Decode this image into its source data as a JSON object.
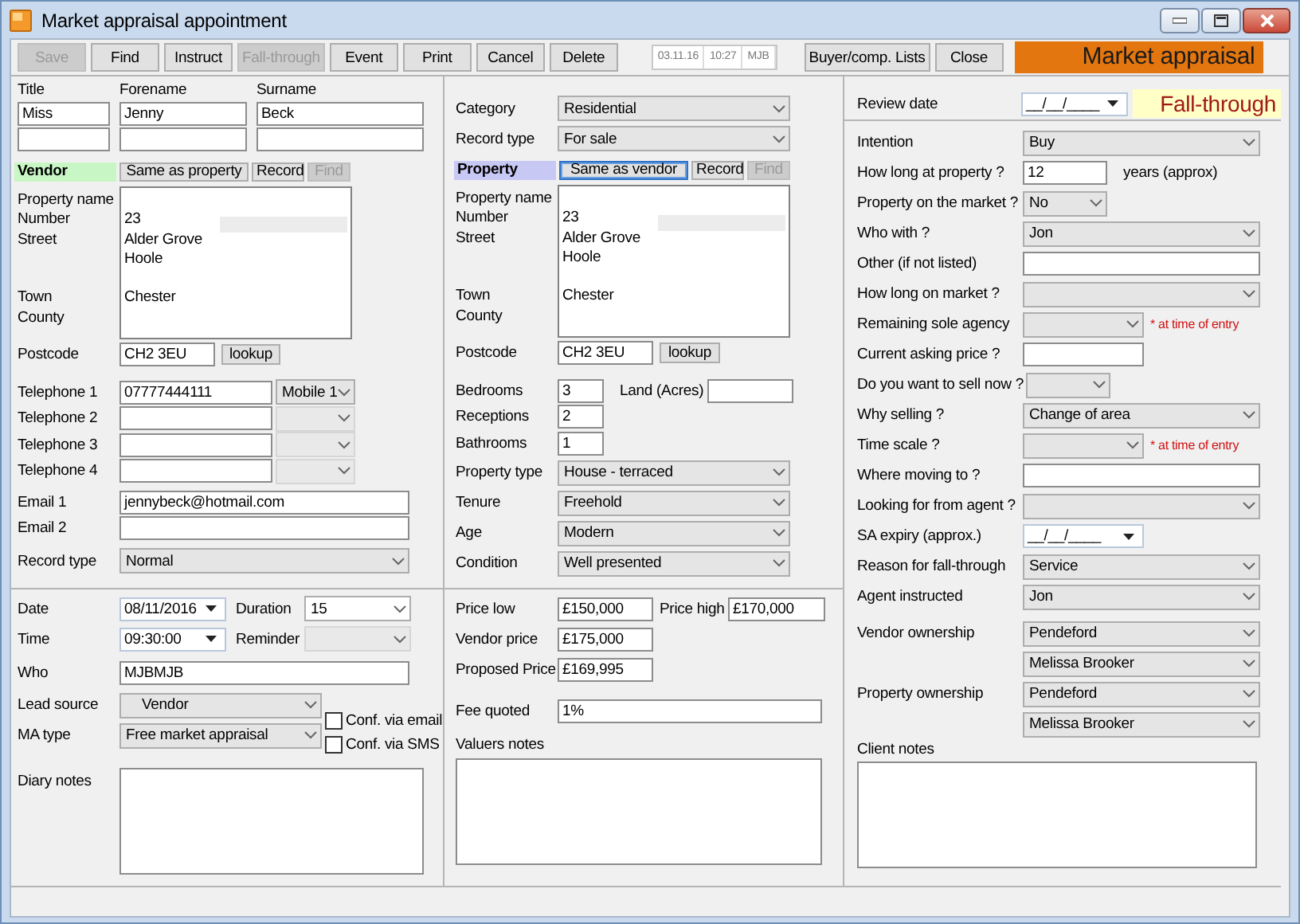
{
  "window": {
    "title": "Market appraisal appointment"
  },
  "toolbar": {
    "buttons": [
      {
        "label": "Save",
        "disabled": true
      },
      {
        "label": "Find",
        "disabled": false
      },
      {
        "label": "Instruct",
        "disabled": false
      },
      {
        "label": "Fall-through",
        "disabled": true
      },
      {
        "label": "Event",
        "disabled": false
      },
      {
        "label": "Print",
        "disabled": false
      },
      {
        "label": "Cancel",
        "disabled": false
      },
      {
        "label": "Delete",
        "disabled": false
      }
    ],
    "stamp": [
      "03.11.16",
      "10:27",
      "MJB"
    ],
    "right_buttons": [
      {
        "label": "Buyer/comp. Lists",
        "disabled": false
      },
      {
        "label": "Close",
        "disabled": false
      }
    ],
    "banner": "Market appraisal"
  },
  "vendor": {
    "name_headings": [
      "Title",
      "Forename",
      "Surname"
    ],
    "name_values": [
      "Miss",
      "Jenny",
      "Beck"
    ],
    "section": {
      "label": "Vendor",
      "buttons": [
        {
          "label": "Same as property",
          "disabled": false,
          "focused": false
        },
        {
          "label": "Record",
          "disabled": false,
          "focused": false
        },
        {
          "label": "Find",
          "disabled": true,
          "focused": false
        }
      ]
    },
    "address_labels": [
      "Property name",
      "Number",
      "Street",
      "Town",
      "County"
    ],
    "address_text": "\n23\nAlder Grove\nHoole\n\nChester",
    "postcode": {
      "label": "Postcode",
      "value": "CH2 3EU",
      "button": "lookup"
    },
    "phones": [
      {
        "label": "Telephone 1",
        "value": "07777444111",
        "type": "Mobile 1",
        "disabled": false
      },
      {
        "label": "Telephone 2",
        "disabled": true
      },
      {
        "label": "Telephone 3",
        "disabled": true
      },
      {
        "label": "Telephone 4",
        "disabled": true
      }
    ],
    "emails": [
      {
        "label": "Email 1",
        "value": "jennybeck@hotmail.com"
      },
      {
        "label": "Email 2"
      }
    ],
    "record_type": {
      "label": "Record type",
      "value": "Normal"
    }
  },
  "appointment": {
    "date": {
      "label": "Date",
      "value": "08/11/2016"
    },
    "duration": {
      "label": "Duration",
      "value": "15",
      "disabled": false
    },
    "time": {
      "label": "Time",
      "value": "09:30:00"
    },
    "reminder": {
      "label": "Reminder",
      "disabled": true
    },
    "who": {
      "label": "Who",
      "value": "MJBMJB"
    },
    "lead_source": {
      "label": "Lead source",
      "value": "Vendor"
    },
    "ma_type": {
      "label": "MA type",
      "value": "Free market appraisal"
    },
    "confirmations": [
      {
        "label": "Conf. via email",
        "checked": false
      },
      {
        "label": "Conf. via SMS",
        "checked": false
      }
    ],
    "diary_notes": {
      "label": "Diary notes"
    }
  },
  "property": {
    "category": {
      "label": "Category",
      "value": "Residential"
    },
    "record_type": {
      "label": "Record type",
      "value": "For sale"
    },
    "section": {
      "label": "Property",
      "buttons": [
        {
          "label": "Same as vendor",
          "disabled": false,
          "focused": true
        },
        {
          "label": "Record",
          "disabled": false,
          "focused": false
        },
        {
          "label": "Find",
          "disabled": true,
          "focused": false
        }
      ]
    },
    "address_labels": [
      "Property name",
      "Number",
      "Street",
      "Town",
      "County"
    ],
    "address_text": "\n23\nAlder Grove\nHoole\n\nChester",
    "postcode": {
      "label": "Postcode",
      "value": "CH2 3EU",
      "button": "lookup"
    },
    "rooms": [
      {
        "label": "Bedrooms",
        "value": "3"
      },
      {
        "label": "Receptions",
        "value": "2"
      },
      {
        "label": "Bathrooms",
        "value": "1"
      }
    ],
    "land": {
      "label": "Land (Acres)"
    },
    "details": [
      {
        "label": "Property type",
        "value": "House - terraced"
      },
      {
        "label": "Tenure",
        "value": "Freehold"
      },
      {
        "label": "Age",
        "value": "Modern"
      },
      {
        "label": "Condition",
        "value": "Well presented"
      }
    ]
  },
  "pricing": {
    "price_low": {
      "label": "Price low",
      "value": "£150,000"
    },
    "price_high": {
      "label": "Price high",
      "value": "£170,000"
    },
    "vendor_price": {
      "label": "Vendor price",
      "value": "£175,000"
    },
    "proposed_price": {
      "label": "Proposed Price",
      "value": "£169,995"
    },
    "fee_quoted": {
      "label": "Fee quoted",
      "value": "1%"
    },
    "valuers_notes": {
      "label": "Valuers notes"
    }
  },
  "client": {
    "review_date": {
      "label": "Review date",
      "value": "__/__/____"
    },
    "status": "Fall-through",
    "rows": [
      {
        "label": "Intention",
        "kind": "select",
        "value": "Buy"
      },
      {
        "label": "How long at property ?",
        "kind": "shorttext",
        "value": "12",
        "unit": "years (approx)"
      },
      {
        "label": "Property on the market ?",
        "kind": "shortselect",
        "value": "No"
      },
      {
        "label": "Who with ?",
        "kind": "select",
        "value": "Jon"
      },
      {
        "label": "Other (if not listed)",
        "kind": "text"
      },
      {
        "label": "How long on market ?",
        "kind": "select"
      },
      {
        "label": "Remaining sole agency",
        "kind": "midselect",
        "note": "* at time of entry"
      },
      {
        "label": "Current asking price ?",
        "kind": "midtext"
      },
      {
        "label": "Do you want to sell now ?",
        "kind": "shortselect"
      },
      {
        "label": "Why selling ?",
        "kind": "select",
        "value": "Change of area"
      },
      {
        "label": "Time scale ?",
        "kind": "midselect",
        "note": "* at time of entry"
      },
      {
        "label": "Where moving to ?",
        "kind": "text"
      },
      {
        "label": "Looking for from agent ?",
        "kind": "select"
      },
      {
        "label": "SA expiry (approx.)",
        "kind": "date",
        "value": "__/__/____"
      },
      {
        "label": "Reason for fall-through",
        "kind": "select",
        "value": "Service"
      },
      {
        "label": "Agent instructed",
        "kind": "select",
        "value": "Jon"
      }
    ],
    "ownership": [
      {
        "label": "Vendor ownership",
        "kind": "select",
        "value": "Pendeford"
      },
      {
        "kind": "select",
        "value": "Melissa Brooker"
      },
      {
        "label": "Property ownership",
        "kind": "select",
        "value": "Pendeford"
      },
      {
        "kind": "select",
        "value": "Melissa Brooker"
      }
    ],
    "client_notes": {
      "label": "Client notes"
    }
  }
}
